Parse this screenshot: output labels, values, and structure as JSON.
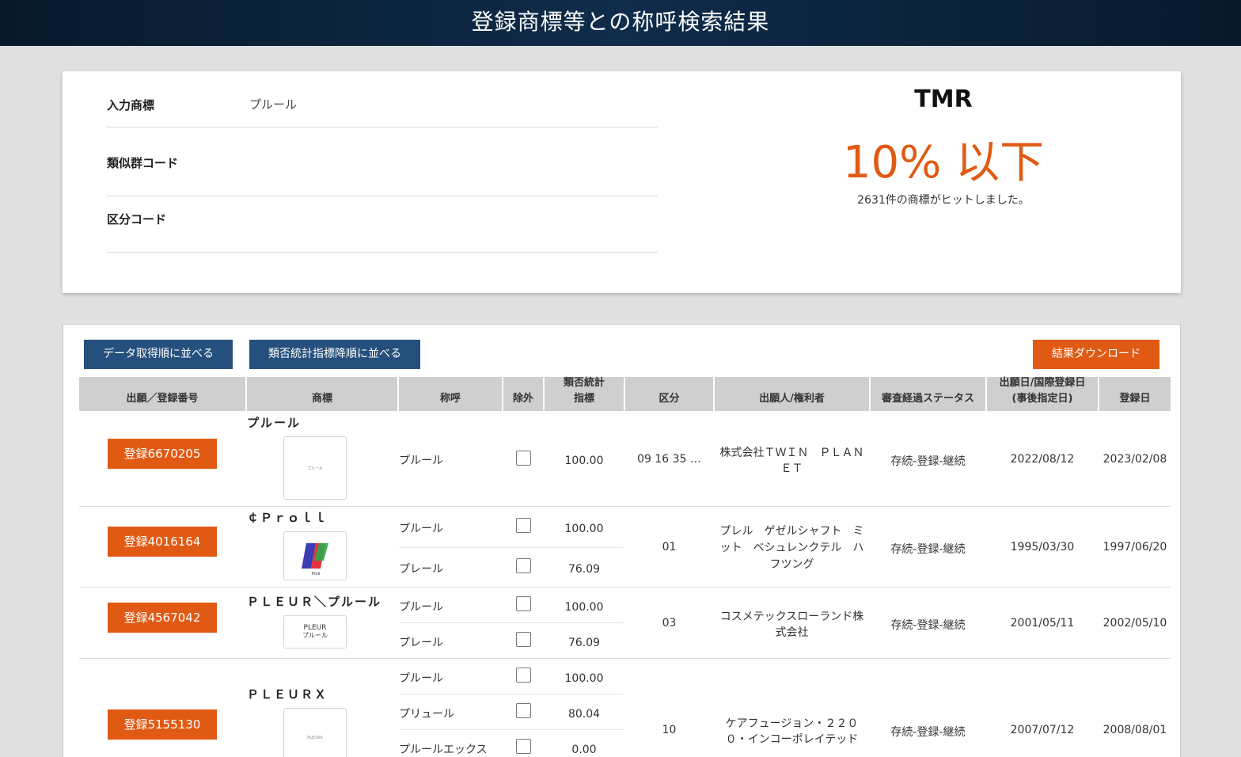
{
  "header": {
    "title": "登録商標等との称呼検索結果"
  },
  "search": {
    "fields": [
      {
        "label": "入力商標",
        "value": "プルール"
      },
      {
        "label": "類似群コード",
        "value": ""
      },
      {
        "label": "区分コード",
        "value": ""
      }
    ],
    "tmr_label": "TMR",
    "tmr_value": "10% 以下",
    "hit_text": "2631件の商標がヒットしました。"
  },
  "toolbar": {
    "sort_by_acquisition": "データ取得順に並べる",
    "sort_by_similarity": "類否統計指標降順に並べる",
    "download": "結果ダウンロード"
  },
  "table": {
    "headers": {
      "number": "出願／登録番号",
      "mark": "商標",
      "reading": "称呼",
      "exclude": "除外",
      "similarity_1": "類否統計",
      "similarity_2": "指標",
      "class": "区分",
      "applicant": "出願人/権利者",
      "status": "審査経過ステータス",
      "filing_1": "出願日/国際登録日",
      "filing_2": "(事後指定日)",
      "reg_date": "登録日"
    },
    "rows": [
      {
        "number": "登録6670205",
        "mark": "プルール",
        "thumb_text": "プルール",
        "readings": [
          {
            "reading": "プルール",
            "score": "100.00"
          }
        ],
        "class": "09 16 35 …",
        "applicant_1": "株式会社ＴＷＩＮ　ＰＬＡＮ",
        "applicant_2": "ＥＴ",
        "status": "存続-登録-継続",
        "filing": "2022/08/12",
        "reg_date": "2023/02/08"
      },
      {
        "number": "登録4016164",
        "mark": "￠Ｐｒｏｌｌ",
        "thumb_text": "Proll",
        "readings": [
          {
            "reading": "プルール",
            "score": "100.00"
          },
          {
            "reading": "プレール",
            "score": "76.09"
          }
        ],
        "class": "01",
        "applicant_1": "プレル　ゲゼルシャフト　ミ",
        "applicant_2": "ット　ベシュレンクテル　ハ",
        "applicant_3": "フツング",
        "status": "存続-登録-継続",
        "filing": "1995/03/30",
        "reg_date": "1997/06/20"
      },
      {
        "number": "登録4567042",
        "mark": "ＰＬＥＵＲ＼プルール",
        "thumb_text_1": "PLEUR",
        "thumb_text_2": "プルール",
        "readings": [
          {
            "reading": "プルール",
            "score": "100.00"
          },
          {
            "reading": "プレール",
            "score": "76.09"
          }
        ],
        "class": "03",
        "applicant_1": "コスメテックスローランド株",
        "applicant_2": "式会社",
        "status": "存続-登録-継続",
        "filing": "2001/05/11",
        "reg_date": "2002/05/10"
      },
      {
        "number": "登録5155130",
        "mark": "ＰＬＥＵＲＸ",
        "thumb_text": "PLEURX",
        "readings": [
          {
            "reading": "プルール",
            "score": "100.00"
          },
          {
            "reading": "プリュール",
            "score": "80.04"
          },
          {
            "reading": "プルールエックス",
            "score": "0.00"
          }
        ],
        "class": "10",
        "applicant_1": "ケアフュージョン・２２０",
        "applicant_2": "０・インコーポレイテッド",
        "status": "存続-登録-継続",
        "filing": "2007/07/12",
        "reg_date": "2008/08/01"
      }
    ]
  },
  "colors": {
    "accent": "#e05a14",
    "button_blue": "#254f7c",
    "header_bg": "#0f2c4a"
  }
}
